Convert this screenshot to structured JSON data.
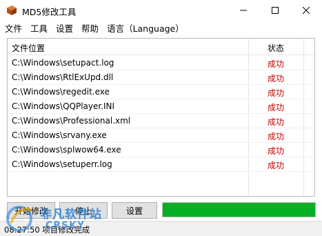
{
  "window": {
    "title": "MD5修改工具"
  },
  "menu": [
    "文件",
    "工具",
    "设置",
    "帮助",
    "语言（Language）"
  ],
  "table": {
    "columns": [
      "文件位置",
      "状态"
    ],
    "rows": [
      {
        "path": "C:\\Windows\\setupact.log",
        "status": "成功"
      },
      {
        "path": "C:\\Windows\\RtlExUpd.dll",
        "status": "成功"
      },
      {
        "path": "C:\\Windows\\regedit.exe",
        "status": "成功"
      },
      {
        "path": "C:\\Windows\\QQPlayer.INI",
        "status": "成功"
      },
      {
        "path": "C:\\Windows\\Professional.xml",
        "status": "成功"
      },
      {
        "path": "C:\\Windows\\srvany.exe",
        "status": "成功"
      },
      {
        "path": "C:\\Windows\\splwow64.exe",
        "status": "成功"
      },
      {
        "path": "C:\\Windows\\setuperr.log",
        "status": "成功"
      }
    ]
  },
  "buttons": {
    "start_label": "开始修改",
    "stop_label": "停止",
    "settings_label": "设置"
  },
  "progress": {
    "fraction": 1.0,
    "color": "#06b025"
  },
  "status_bar": {
    "text": "08:27:50 项目修改完成"
  },
  "watermark": {
    "main": "非凡软件站",
    "sub": "CRSKY"
  },
  "colors": {
    "status_success": "#c00000",
    "progress": "#06b025"
  }
}
